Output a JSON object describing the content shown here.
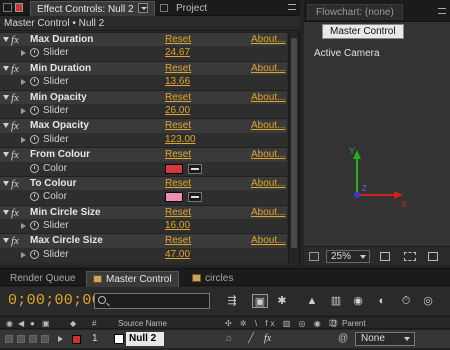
{
  "effect_controls": {
    "tab_label": "Effect Controls: Null 2",
    "project_tab_label": "Project",
    "breadcrumb": "Master Control • Null 2",
    "reset_label": "Reset",
    "about_label": "About...",
    "effects": [
      {
        "name": "Max Duration",
        "param": "Slider",
        "value": "24.67",
        "kind": "slider"
      },
      {
        "name": "Min Duration",
        "param": "Slider",
        "value": "13.66",
        "kind": "slider"
      },
      {
        "name": "Min Opacity",
        "param": "Slider",
        "value": "26.00",
        "kind": "slider"
      },
      {
        "name": "Max Opacity",
        "param": "Slider",
        "value": "123.00",
        "kind": "slider"
      },
      {
        "name": "From Colour",
        "param": "Color",
        "color": "#d93838",
        "kind": "color"
      },
      {
        "name": "To Colour",
        "param": "Color",
        "color": "#f08ab8",
        "kind": "color"
      },
      {
        "name": "Min Circle Size",
        "param": "Slider",
        "value": "16.00",
        "kind": "slider"
      },
      {
        "name": "Max Circle Size",
        "param": "Slider",
        "value": "47.00",
        "kind": "slider"
      }
    ]
  },
  "flowchart": {
    "tab_label": "Flowchart: (none)",
    "button_label": "Master Control",
    "camera_label": "Active Camera",
    "zoom_value": "25%",
    "axis_labels": {
      "x": "X",
      "y": "Y",
      "z": "Z"
    }
  },
  "timeline": {
    "tabs": [
      {
        "label": "Render Queue",
        "active": false
      },
      {
        "label": "Master Control",
        "active": true
      },
      {
        "label": "circles",
        "active": false
      }
    ],
    "timecode": "0;00;00;00",
    "search_placeholder": "",
    "headers": {
      "number": "#",
      "source_name": "Source Name",
      "parent": "Parent"
    },
    "layer": {
      "number": "1",
      "name": "Null 2",
      "parent": "None",
      "label_color": "#c53232"
    }
  },
  "colors": {
    "accent_orange": "#e0a62a",
    "x_axis": "#d02020",
    "y_axis": "#20b020",
    "z_axis": "#3a3ad0"
  }
}
